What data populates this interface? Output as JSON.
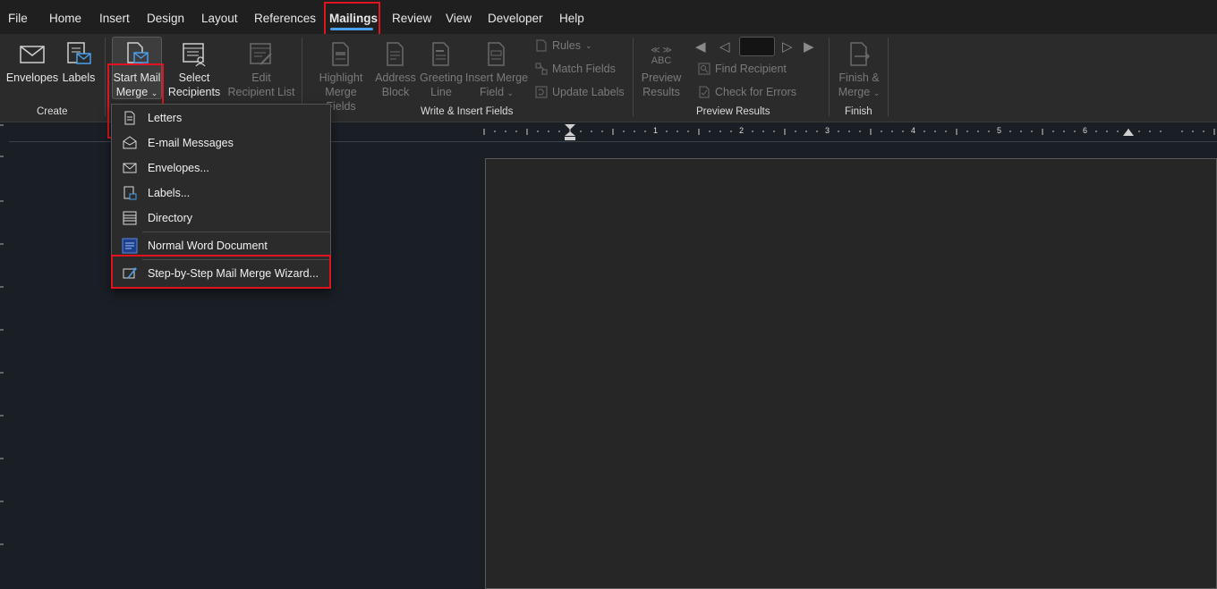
{
  "menubar": {
    "tabs": [
      "File",
      "Home",
      "Insert",
      "Design",
      "Layout",
      "References",
      "Mailings",
      "Review",
      "View",
      "Developer",
      "Help"
    ],
    "active": "Mailings"
  },
  "ribbon": {
    "create": {
      "label": "Create",
      "envelopes": "Envelopes",
      "labels": "Labels"
    },
    "start_mail_merge": {
      "line1": "Start Mail",
      "line2": "Merge"
    },
    "select_recipients": {
      "line1": "Select",
      "line2": "Recipients"
    },
    "edit_recipient_list": {
      "line1": "Edit",
      "line2": "Recipient List"
    },
    "write_insert": {
      "label": "Write & Insert Fields",
      "highlight": {
        "line1": "Highlight",
        "line2": "Merge Fields"
      },
      "address": {
        "line1": "Address",
        "line2": "Block"
      },
      "greeting": {
        "line1": "Greeting",
        "line2": "Line"
      },
      "insert_merge": {
        "line1": "Insert Merge",
        "line2": "Field"
      },
      "rules": "Rules",
      "match_fields": "Match Fields",
      "update_labels": "Update Labels"
    },
    "preview": {
      "label": "Preview Results",
      "abc": "ABC",
      "preview_results": {
        "line1": "Preview",
        "line2": "Results"
      },
      "find_recipient": "Find Recipient",
      "check_errors": "Check for Errors"
    },
    "finish": {
      "label": "Finish",
      "finish_merge": {
        "line1": "Finish &",
        "line2": "Merge"
      }
    }
  },
  "ruler": {
    "numbers": [
      "1",
      "2",
      "3",
      "4",
      "5",
      "6"
    ]
  },
  "dropdown": {
    "items": [
      {
        "label": "Letters",
        "icon": "letter-icon"
      },
      {
        "label": "E-mail Messages",
        "icon": "email-icon"
      },
      {
        "label": "Envelopes...",
        "icon": "envelope-icon"
      },
      {
        "label": "Labels...",
        "icon": "labels-icon"
      },
      {
        "label": "Directory",
        "icon": "directory-icon"
      },
      {
        "label": "Normal Word Document",
        "icon": "word-document-icon"
      },
      {
        "label": "Step-by-Step Mail Merge Wizard...",
        "icon": "wizard-icon"
      }
    ]
  },
  "colors": {
    "highlight": "#e0141e",
    "accent": "#4aa0ec"
  }
}
